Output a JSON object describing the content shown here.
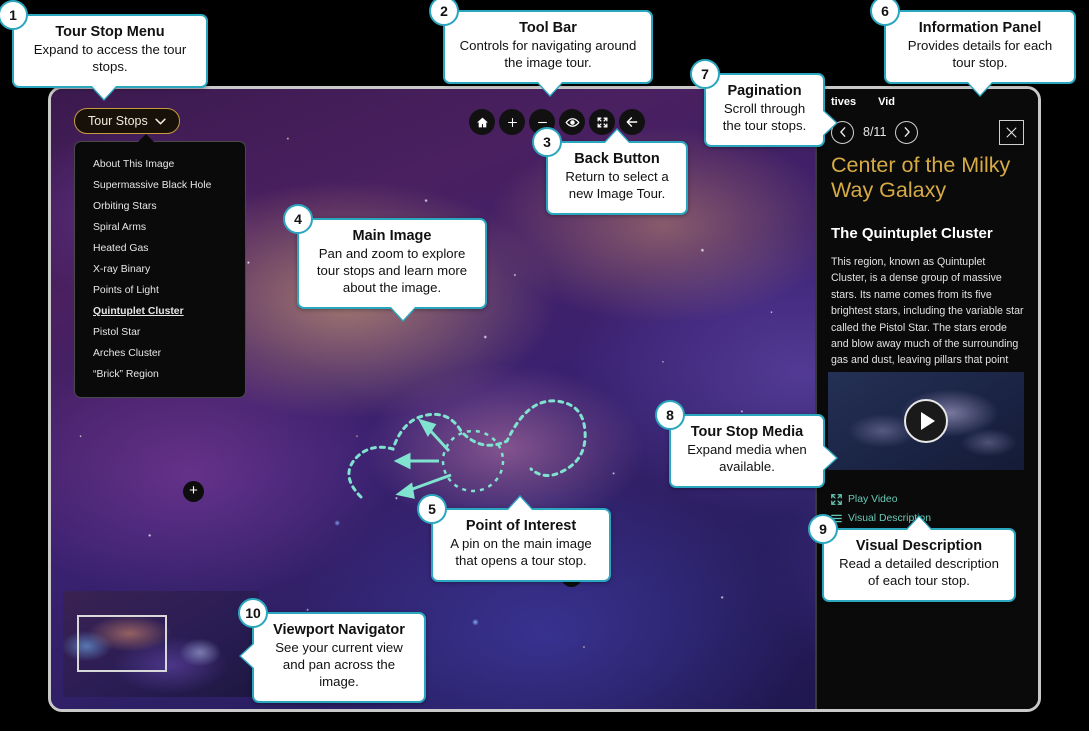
{
  "app": {
    "tour_stops_button": "Tour Stops",
    "chevron_icon": "chevron-down-icon",
    "tour_stops": [
      "About This Image",
      "Supermassive Black Hole",
      "Orbiting Stars",
      "Spiral Arms",
      "Heated Gas",
      "X-ray Binary",
      "Points of Light",
      "Quintuplet Cluster",
      "Pistol Star",
      "Arches Cluster",
      "“Brick” Region"
    ],
    "active_tour_stop": "Quintuplet Cluster",
    "toolbar": [
      {
        "name": "home-icon",
        "glyph": "⌂",
        "label": "Home"
      },
      {
        "name": "zoom-in-icon",
        "glyph": "＋",
        "label": "Zoom In"
      },
      {
        "name": "zoom-out-icon",
        "glyph": "−",
        "label": "Zoom Out"
      },
      {
        "name": "eye-icon",
        "glyph": "◉",
        "label": "Toggle Points of Interest"
      },
      {
        "name": "fullscreen-icon",
        "glyph": "⛶",
        "label": "Full Screen"
      },
      {
        "name": "back-arrow-icon",
        "glyph": "←",
        "label": "Back"
      }
    ]
  },
  "panel": {
    "tabs": [
      "tives",
      "Vid"
    ],
    "prev_icon": "chevron-left-icon",
    "next_icon": "chevron-right-icon",
    "pagination": "8/11",
    "close_icon": "close-icon",
    "title": "Center of the Milky Way Galaxy",
    "subtitle": "The Quintuplet Cluster",
    "body": "This region, known as Quintuplet Cluster, is a dense group of massive stars. Its name comes from its five brightest stars, including the variable star called the Pistol Star. The stars erode and blow away much of the surrounding gas and dust, leaving pillars that point towards the bright stars.",
    "media_play_icon": "play-icon",
    "link_play_video": "Play Video",
    "link_play_icon": "expand-icon",
    "link_visual_description": "Visual Description",
    "link_vd_icon": "list-lines-icon",
    "accent_gold": "#d6ab45",
    "accent_teal": "#67c9b6"
  },
  "callouts": [
    {
      "num": "1",
      "title": "Tour Stop Menu",
      "text": "Expand to access the tour stops."
    },
    {
      "num": "2",
      "title": "Tool Bar",
      "text": "Controls for navigating around the image tour."
    },
    {
      "num": "3",
      "title": "Back Button",
      "text": "Return to select a new Image Tour."
    },
    {
      "num": "4",
      "title": "Main Image",
      "text": "Pan and zoom to explore tour stops and learn more about the image."
    },
    {
      "num": "5",
      "title": "Point of Interest",
      "text": "A pin on the main image that opens a tour stop."
    },
    {
      "num": "6",
      "title": "Information Panel",
      "text": "Provides details for each tour stop."
    },
    {
      "num": "7",
      "title": "Pagination",
      "text": "Scroll through the tour stops."
    },
    {
      "num": "8",
      "title": "Tour Stop Media",
      "text": "Expand media when available."
    },
    {
      "num": "9",
      "title": "Visual Description",
      "text": "Read a detailed description of each tour stop."
    },
    {
      "num": "10",
      "title": "Viewport Navigator",
      "text": "See your current view and pan across the image."
    }
  ],
  "colors": {
    "callout_border": "#2aa6bf",
    "frame": "#c9c9c9",
    "page_bg": "#000000"
  }
}
